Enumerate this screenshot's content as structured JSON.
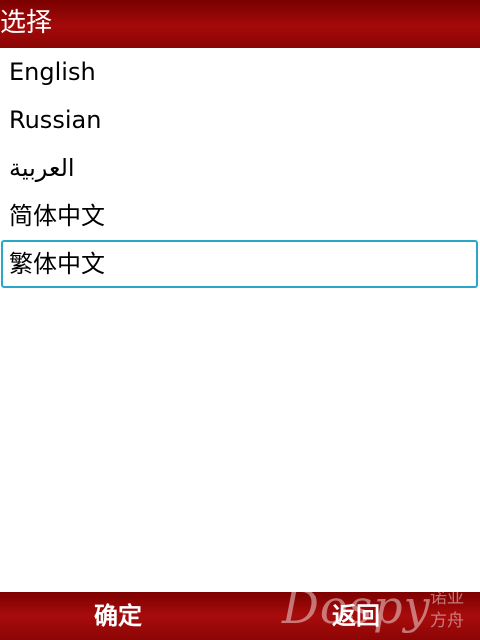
{
  "header": {
    "title": "选择"
  },
  "languages": [
    {
      "label": "English"
    },
    {
      "label": "Russian"
    },
    {
      "label": "العربية"
    },
    {
      "label": "简体中文"
    },
    {
      "label": "繁体中文"
    }
  ],
  "selected_index": 4,
  "softkeys": {
    "left_label": "确定",
    "right_label": "返回"
  },
  "watermark": {
    "brand": "Dospy",
    "line1": "诺亚",
    "line2": "方舟"
  },
  "colors": {
    "bar_red": "#9a0808",
    "selection_border": "#2aa7c6",
    "background": "#ffffff"
  }
}
